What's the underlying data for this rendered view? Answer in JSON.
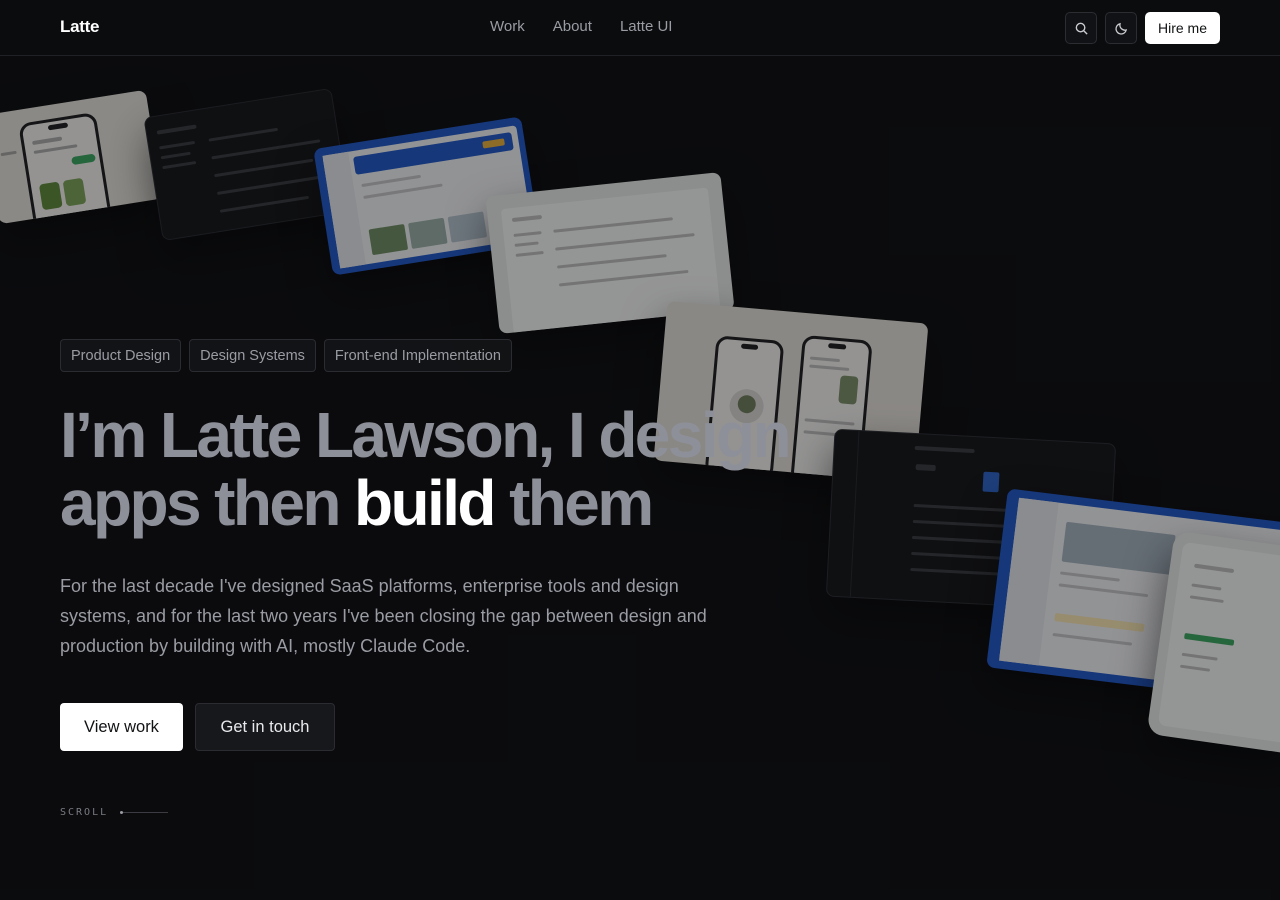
{
  "header": {
    "logo": "Latte",
    "nav": [
      {
        "label": "Work"
      },
      {
        "label": "About"
      },
      {
        "label": "Latte UI"
      }
    ],
    "search_icon": "search-icon",
    "theme_icon": "moon-icon",
    "hire_label": "Hire me"
  },
  "hero": {
    "tags": [
      "Product Design",
      "Design Systems",
      "Front-end Implementation"
    ],
    "headline": {
      "part1": "I’m Latte Lawson, I design apps then ",
      "emphasis": "build",
      "part2": " them"
    },
    "lead": "For the last decade I've designed SaaS platforms, enterprise tools and design systems, and for the last two years I've been closing the gap between design and production by building with AI, mostly Claude Code.",
    "cta_primary": "View work",
    "cta_secondary": "Get in touch"
  },
  "scroll": {
    "label": "SCROLL"
  },
  "colors": {
    "background": "#0b0c0e",
    "headline_muted": "#8e9099",
    "headline_strong": "#ffffff",
    "accent_blue": "#1e57c9"
  }
}
